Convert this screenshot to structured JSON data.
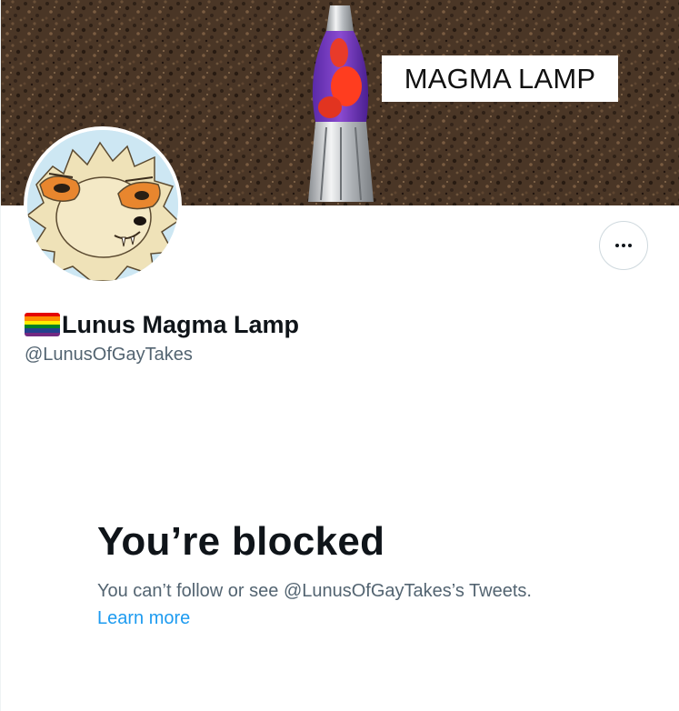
{
  "banner": {
    "label": "MAGMA LAMP"
  },
  "profile": {
    "flag_icon": "rainbow-flag-icon",
    "display_name": "Lunus Magma Lamp",
    "handle": "@LunusOfGayTakes",
    "more_icon": "more-horizontal-icon"
  },
  "blocked": {
    "title": "You’re blocked",
    "description": "You can’t follow or see @LunusOfGayTakes’s Tweets.",
    "learn_more": "Learn more"
  },
  "colors": {
    "text_primary": "#0f1419",
    "text_secondary": "#536471",
    "link": "#1d9bf0",
    "border": "#cfd9de"
  }
}
